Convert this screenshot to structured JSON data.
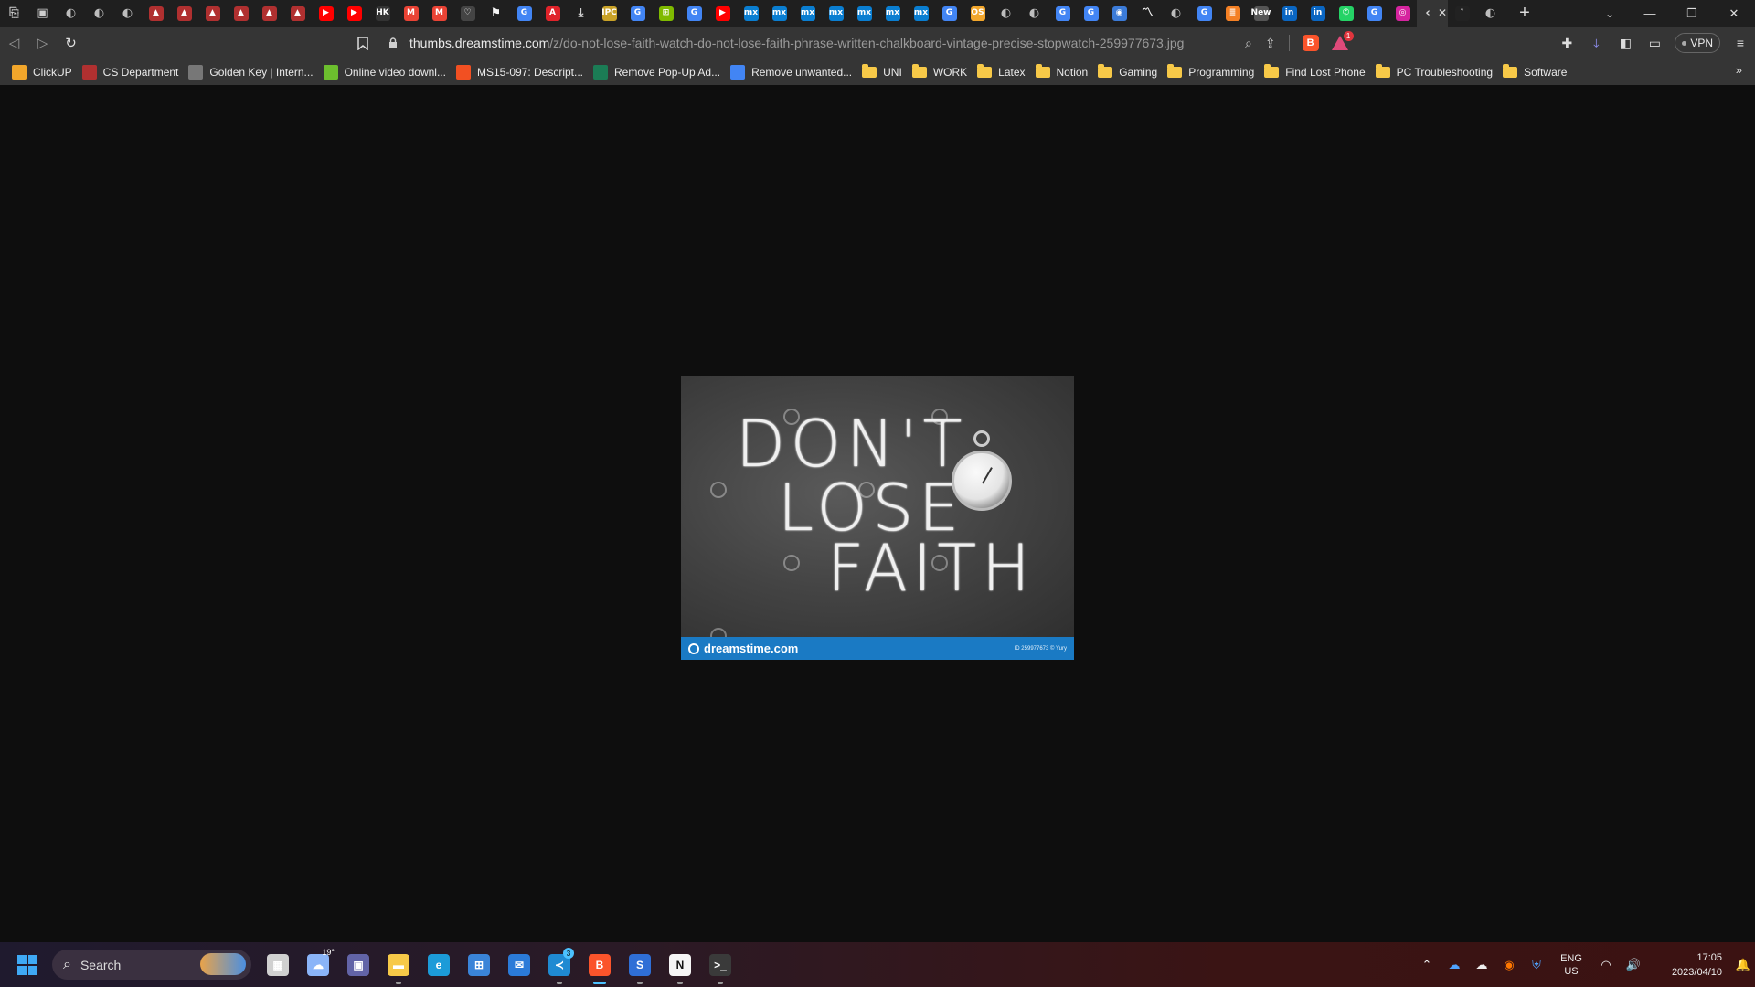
{
  "browser": {
    "tabs": [
      {
        "icon": "bookmark-page-icon",
        "color": "#cfcfcf",
        "glyph": "⎘"
      },
      {
        "icon": "save-icon",
        "color": "#cfcfcf",
        "glyph": "▣"
      },
      {
        "icon": "globe-icon",
        "color": "#bdbdbd",
        "glyph": "◐"
      },
      {
        "icon": "globe-icon",
        "color": "#bdbdbd",
        "glyph": "◐"
      },
      {
        "icon": "globe-icon",
        "color": "#bdbdbd",
        "glyph": "◐"
      },
      {
        "icon": "university-icon",
        "color": "#b03030",
        "glyph": "▲"
      },
      {
        "icon": "university-icon",
        "color": "#b03030",
        "glyph": "▲"
      },
      {
        "icon": "university-icon",
        "color": "#b03030",
        "glyph": "▲"
      },
      {
        "icon": "university-icon",
        "color": "#b03030",
        "glyph": "▲"
      },
      {
        "icon": "university-icon",
        "color": "#b03030",
        "glyph": "▲"
      },
      {
        "icon": "university-icon",
        "color": "#b03030",
        "glyph": "▲"
      },
      {
        "icon": "youtube-icon",
        "color": "#ff0000",
        "glyph": "▶"
      },
      {
        "icon": "youtube-icon",
        "color": "#ff0000",
        "glyph": "▶"
      },
      {
        "icon": "hk-icon",
        "color": "#333333",
        "glyph": "HK"
      },
      {
        "icon": "gmail-icon",
        "color": "#ea4335",
        "glyph": "M"
      },
      {
        "icon": "gmail-icon",
        "color": "#ea4335",
        "glyph": "M"
      },
      {
        "icon": "heart-icon",
        "color": "#444444",
        "glyph": "♡"
      },
      {
        "icon": "flag-icon",
        "color": "#f5f5f5",
        "glyph": "⚑"
      },
      {
        "icon": "google-icon",
        "color": "#4285f4",
        "glyph": "G"
      },
      {
        "icon": "adobe-icon",
        "color": "#e0232a",
        "glyph": "A"
      },
      {
        "icon": "download-icon",
        "color": "#cfcfcf",
        "glyph": "⤓"
      },
      {
        "icon": "ipc-icon",
        "color": "#c9a227",
        "glyph": "IPC"
      },
      {
        "icon": "google-icon",
        "color": "#4285f4",
        "glyph": "G"
      },
      {
        "icon": "microsoft-icon",
        "color": "#7fba00",
        "glyph": "⊞"
      },
      {
        "icon": "google-icon",
        "color": "#4285f4",
        "glyph": "G"
      },
      {
        "icon": "youtube-icon",
        "color": "#ff0000",
        "glyph": "▶"
      },
      {
        "icon": "mx-icon",
        "color": "#0a7ed1",
        "glyph": "mx"
      },
      {
        "icon": "mx-icon",
        "color": "#0a7ed1",
        "glyph": "mx"
      },
      {
        "icon": "mx-icon",
        "color": "#0a7ed1",
        "glyph": "mx"
      },
      {
        "icon": "mx-icon",
        "color": "#0a7ed1",
        "glyph": "mx"
      },
      {
        "icon": "mx-icon",
        "color": "#0a7ed1",
        "glyph": "mx"
      },
      {
        "icon": "mx-icon",
        "color": "#0a7ed1",
        "glyph": "mx"
      },
      {
        "icon": "mx-icon",
        "color": "#0a7ed1",
        "glyph": "mx"
      },
      {
        "icon": "google-icon",
        "color": "#4285f4",
        "glyph": "G"
      },
      {
        "icon": "os-icon",
        "color": "#f2a62b",
        "glyph": "OS"
      },
      {
        "icon": "globe-icon",
        "color": "#bdbdbd",
        "glyph": "◐"
      },
      {
        "icon": "globe-icon",
        "color": "#bdbdbd",
        "glyph": "◐"
      },
      {
        "icon": "google-icon",
        "color": "#4285f4",
        "glyph": "G"
      },
      {
        "icon": "google-icon",
        "color": "#4285f4",
        "glyph": "G"
      },
      {
        "icon": "compass-icon",
        "color": "#3b7bd8",
        "glyph": "◉"
      },
      {
        "icon": "chart-icon",
        "color": "#f5f5f5",
        "glyph": "〽"
      },
      {
        "icon": "globe-icon",
        "color": "#bdbdbd",
        "glyph": "◐"
      },
      {
        "icon": "google-icon",
        "color": "#4285f4",
        "glyph": "G"
      },
      {
        "icon": "stack-icon",
        "color": "#f48024",
        "glyph": "≣"
      },
      {
        "icon": "news-icon",
        "color": "#555555",
        "glyph": "New"
      },
      {
        "icon": "linkedin-icon",
        "color": "#0a66c2",
        "glyph": "in"
      },
      {
        "icon": "linkedin-icon",
        "color": "#0a66c2",
        "glyph": "in"
      },
      {
        "icon": "whatsapp-icon",
        "color": "#25d366",
        "glyph": "✆"
      },
      {
        "icon": "google-icon",
        "color": "#4285f4",
        "glyph": "G"
      },
      {
        "icon": "instagram-icon",
        "color": "#d6249f",
        "glyph": "◎"
      }
    ],
    "active_tab": {
      "icon": "loading-icon",
      "glyph": "‹",
      "close": "✕"
    },
    "trailing_tabs": [
      {
        "icon": "dark-tab-icon",
        "color": "#222222",
        "glyph": "❜"
      },
      {
        "icon": "globe-icon",
        "color": "#bdbdbd",
        "glyph": "◐"
      }
    ],
    "new_tab_glyph": "+",
    "tab_search_glyph": "⌄",
    "window_controls": {
      "minimize": "—",
      "restore": "❐",
      "close": "✕"
    },
    "nav": {
      "back": "◁",
      "forward": "▷",
      "reload": "↻"
    },
    "bookmark_glyph": "🔖",
    "url_host": "thumbs.dreamstime.com",
    "url_path": "/z/do-not-lose-faith-watch-do-not-lose-faith-phrase-written-chalkboard-vintage-precise-stopwatch-259977673.jpg",
    "lock_glyph": "🔒",
    "url_actions": {
      "zoom": "⌕",
      "share": "⇪"
    },
    "brave_glyph": "B",
    "rewards_badge": "1",
    "right_tools": {
      "extensions": "✚",
      "downloads": "⤓",
      "sidebar": "◧",
      "wallet": "▭",
      "menu": "≡"
    },
    "vpn_label": "VPN",
    "bookmarks": [
      {
        "type": "link",
        "label": "ClickUP",
        "icon": "clickup-icon",
        "color": "#f2a62b"
      },
      {
        "type": "link",
        "label": "CS Department",
        "icon": "university-icon",
        "color": "#b03030"
      },
      {
        "type": "link",
        "label": "Golden Key | Intern...",
        "icon": "globe-icon",
        "color": "#777777"
      },
      {
        "type": "link",
        "label": "Online video downl...",
        "icon": "download-arrow-icon",
        "color": "#6cbf2e"
      },
      {
        "type": "link",
        "label": "MS15-097: Descript...",
        "icon": "microsoft-icon",
        "color": "#f25022"
      },
      {
        "type": "link",
        "label": "Remove Pop-Up Ad...",
        "icon": "leaf-icon",
        "color": "#1b7c55"
      },
      {
        "type": "link",
        "label": "Remove unwanted...",
        "icon": "google-icon",
        "color": "#4285f4"
      },
      {
        "type": "folder",
        "label": "UNI"
      },
      {
        "type": "folder",
        "label": "WORK"
      },
      {
        "type": "folder",
        "label": "Latex"
      },
      {
        "type": "folder",
        "label": "Notion"
      },
      {
        "type": "folder",
        "label": "Gaming"
      },
      {
        "type": "folder",
        "label": "Programming"
      },
      {
        "type": "folder",
        "label": "Find Lost Phone"
      },
      {
        "type": "folder",
        "label": "PC Troubleshooting"
      },
      {
        "type": "folder",
        "label": "Software"
      }
    ],
    "bookmarks_more": "»"
  },
  "image": {
    "chalk_lines": [
      "DON'T",
      "LOSE",
      "FAITH"
    ],
    "footer_brand": "dreamstime.com",
    "footer_id": "ID 259977673 © Yury",
    "stopwatch_alt": "stopwatch-icon"
  },
  "taskbar": {
    "search_label": "Search",
    "apps": [
      {
        "name": "task-view-icon",
        "color": "#d0d0d0",
        "glyph": "▦",
        "state": "none"
      },
      {
        "name": "weather-icon",
        "color": "#8ab4f8",
        "glyph": "☁",
        "state": "none",
        "temp": "19°"
      },
      {
        "name": "teams-chat-icon",
        "color": "#6264a7",
        "glyph": "▣",
        "state": "none"
      },
      {
        "name": "file-explorer-icon",
        "color": "#f7c948",
        "glyph": "▬",
        "state": "open"
      },
      {
        "name": "edge-icon",
        "color": "#1c9bd8",
        "glyph": "e",
        "state": "none"
      },
      {
        "name": "ms-store-icon",
        "color": "#3a84d8",
        "glyph": "⊞",
        "state": "none"
      },
      {
        "name": "mail-icon",
        "color": "#2b7bd8",
        "glyph": "✉",
        "state": "none"
      },
      {
        "name": "vscode-icon",
        "color": "#1f8ad2",
        "glyph": "≺",
        "state": "open",
        "badge": "3"
      },
      {
        "name": "brave-icon",
        "color": "#fb542b",
        "glyph": "B",
        "state": "active"
      },
      {
        "name": "simplenote-icon",
        "color": "#2f6fd6",
        "glyph": "S",
        "state": "open"
      },
      {
        "name": "notion-icon",
        "color": "#f5f5f5",
        "glyph": "N",
        "state": "open"
      },
      {
        "name": "terminal-icon",
        "color": "#3a3a3a",
        "glyph": ">_",
        "state": "open"
      }
    ],
    "tray": {
      "chevron": "⌃",
      "onedrive": "☁",
      "cloud": "☁",
      "avast": "◉",
      "shield": "⛨",
      "lang_top": "ENG",
      "lang_bottom": "US",
      "wifi": "◠",
      "volume": "🔊",
      "time": "17:05",
      "date": "2023/04/10",
      "notification": "🔔"
    }
  }
}
